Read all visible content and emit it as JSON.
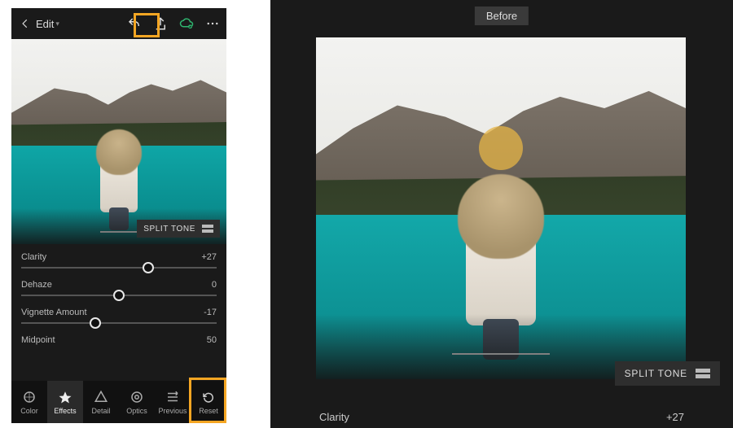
{
  "colors": {
    "highlight": "#f5a623",
    "bg_dark": "#1a1a1a"
  },
  "before_label": "Before",
  "topbar": {
    "title": "Edit",
    "icons": {
      "back": "back-chevron-icon",
      "undo": "undo-icon",
      "share": "share-icon",
      "cloud": "cloud-sync-icon",
      "more": "more-icon"
    }
  },
  "split_tone_label": "SPLIT TONE",
  "sliders": [
    {
      "label": "Clarity",
      "value": "+27",
      "knob_pct": 65,
      "bipolar": true
    },
    {
      "label": "Dehaze",
      "value": "0",
      "knob_pct": 50,
      "bipolar": true
    },
    {
      "label": "Vignette Amount",
      "value": "-17",
      "knob_pct": 38,
      "bipolar": true
    },
    {
      "label": "Midpoint",
      "value": "50",
      "knob_pct": 50,
      "bipolar": false
    }
  ],
  "bottombar": [
    {
      "label": "Color",
      "icon": "color-wheel-icon"
    },
    {
      "label": "Effects",
      "icon": "effects-icon",
      "selected": true
    },
    {
      "label": "Detail",
      "icon": "detail-icon"
    },
    {
      "label": "Optics",
      "icon": "optics-icon"
    },
    {
      "label": "Previous",
      "icon": "previous-icon"
    },
    {
      "label": "Reset",
      "icon": "reset-icon"
    }
  ],
  "right_panel": {
    "split_tone_label": "SPLIT TONE",
    "slider": {
      "label": "Clarity",
      "value": "+27"
    }
  }
}
